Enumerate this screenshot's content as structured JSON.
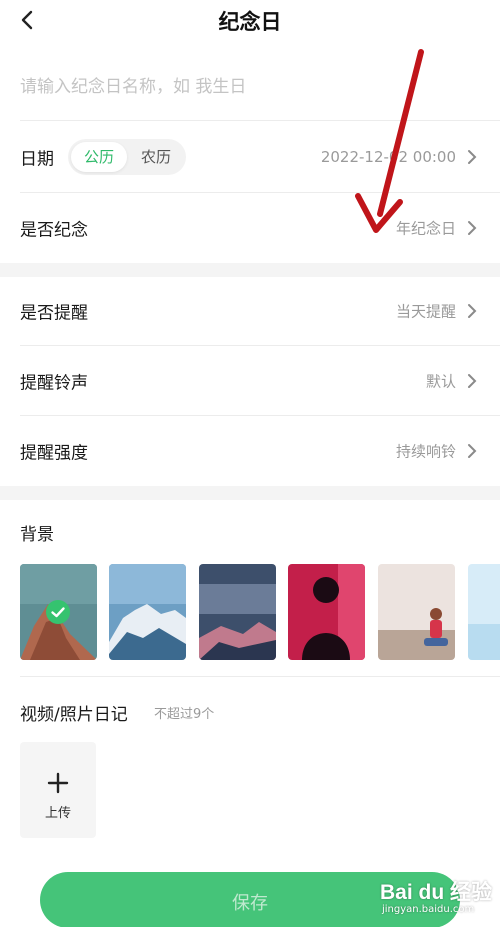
{
  "header": {
    "title": "纪念日",
    "back_icon": "back-arrow-icon"
  },
  "name_input": {
    "placeholder": "请输入纪念日名称，如 我生日",
    "value": ""
  },
  "date_row": {
    "label": "日期",
    "calendar_options": [
      "公历",
      "农历"
    ],
    "selected_calendar": "公历",
    "value": "2022-12-02 00:00"
  },
  "commemorate_row": {
    "label": "是否纪念",
    "value": "年纪念日"
  },
  "reminder_row": {
    "label": "是否提醒",
    "value": "当天提醒"
  },
  "ringtone_row": {
    "label": "提醒铃声",
    "value": "默认"
  },
  "intensity_row": {
    "label": "提醒强度",
    "value": "持续响铃"
  },
  "background": {
    "title": "背景",
    "thumbnails": [
      "mountain-peak",
      "snowy-range",
      "cloudy-mountain",
      "neon-silhouette",
      "girl-seaside",
      "sky-partial"
    ],
    "selected_index": 0
  },
  "diary": {
    "title": "视频/照片日记",
    "hint": "不超过9个",
    "upload_label": "上传"
  },
  "save_button": {
    "label": "保存"
  },
  "watermark": {
    "brand": "Bai du 经验",
    "url": "jingyan.baidu.com"
  },
  "colors": {
    "accent": "#2fba6a",
    "save_bg": "#45c479",
    "arrow": "#c0151a"
  }
}
